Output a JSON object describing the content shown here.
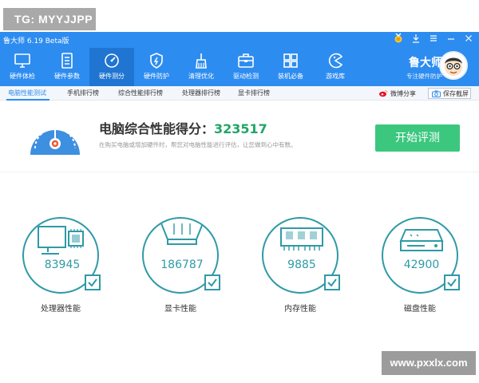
{
  "watermarks": {
    "top_left": "TG: MYYJJPP",
    "bottom_right": "www.pxxlx.com"
  },
  "window": {
    "title": "鲁大师 6.19 Beta版",
    "controls": [
      "award-icon",
      "download-icon",
      "menu-icon",
      "minimize-icon",
      "close-icon"
    ]
  },
  "toolbar": {
    "items": [
      {
        "label": "硬件体检",
        "icon": "monitor-icon"
      },
      {
        "label": "硬件参数",
        "icon": "document-icon"
      },
      {
        "label": "硬件测分",
        "icon": "speedometer-icon",
        "active": true
      },
      {
        "label": "硬件防护",
        "icon": "shield-icon"
      },
      {
        "label": "清理优化",
        "icon": "broom-icon"
      },
      {
        "label": "驱动检测",
        "icon": "toolbox-icon"
      },
      {
        "label": "装机必备",
        "icon": "apps-icon"
      },
      {
        "label": "游戏库",
        "icon": "pacman-icon"
      }
    ]
  },
  "brand": {
    "name": "鲁大师",
    "subtitle": "专注硬件防护"
  },
  "tabs": {
    "items": [
      {
        "label": "电脑性能测试",
        "active": true
      },
      {
        "label": "手机排行榜"
      },
      {
        "label": "综合性能排行榜"
      },
      {
        "label": "处理器排行榜"
      },
      {
        "label": "显卡排行榜"
      }
    ],
    "share_label": "微博分享",
    "screenshot_label": "保存截屏"
  },
  "score": {
    "title_prefix": "电脑综合性能得分：",
    "value": "323517",
    "description": "在购买电脑或增加硬件时，帮您对电脑性能进行评估，让您做到心中有数。",
    "start_label": "开始评测"
  },
  "colors": {
    "header_blue": "#2d8cf0",
    "accent_green": "#3cc77f",
    "score_green": "#21a566",
    "metric_teal": "#2f9aa6"
  },
  "metrics": [
    {
      "value": "83945",
      "label": "处理器性能",
      "icon": "cpu-icon"
    },
    {
      "value": "186787",
      "label": "显卡性能",
      "icon": "gpu-icon"
    },
    {
      "value": "9885",
      "label": "内存性能",
      "icon": "memory-icon"
    },
    {
      "value": "42900",
      "label": "磁盘性能",
      "icon": "disk-icon"
    }
  ]
}
